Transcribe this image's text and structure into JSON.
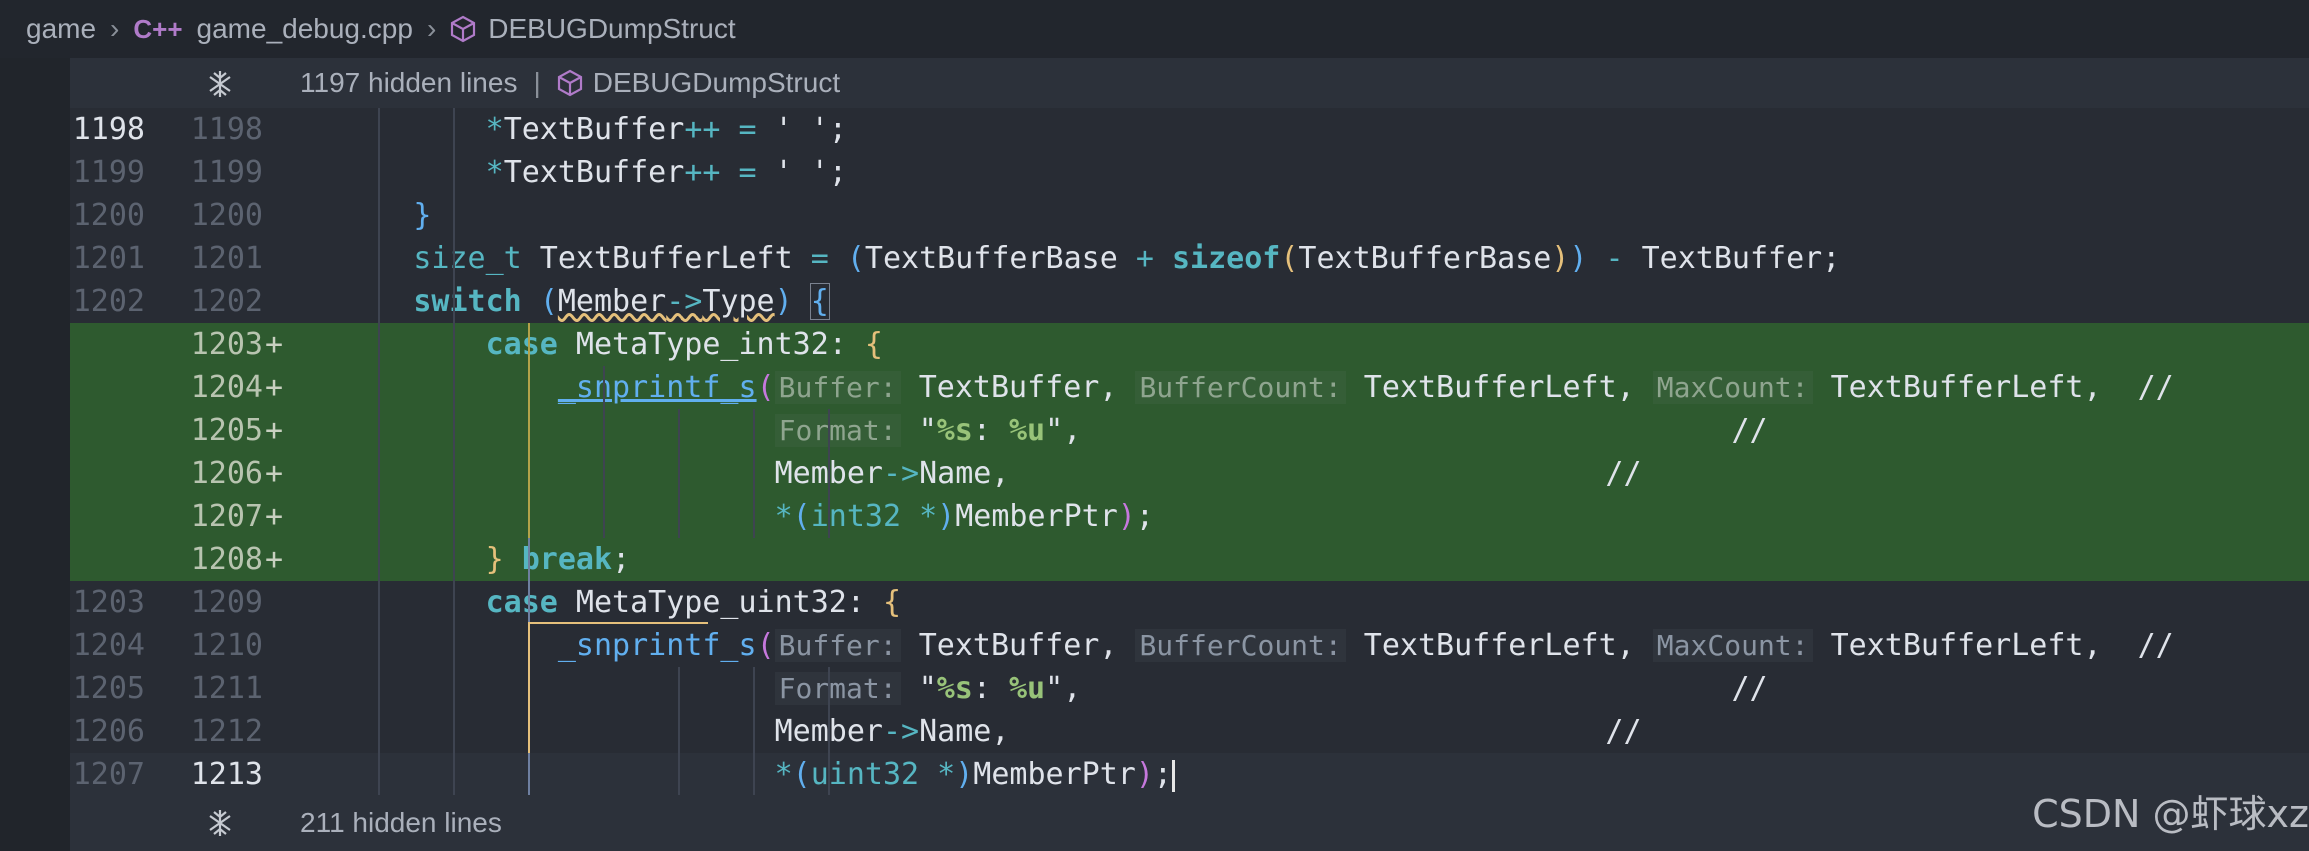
{
  "breadcrumb": {
    "folder": "game",
    "lang_icon": "C++",
    "file": "game_debug.cpp",
    "symbol": "DEBUGDumpStruct"
  },
  "fold_top": {
    "count_text": "1197 hidden lines",
    "symbol": "DEBUGDumpStruct"
  },
  "fold_bottom": {
    "count_text": "211 hidden lines"
  },
  "lines": [
    {
      "old": "1198",
      "new": "1198"
    },
    {
      "old": "1199",
      "new": "1199"
    },
    {
      "old": "1200",
      "new": "1200"
    },
    {
      "old": "1201",
      "new": "1201"
    },
    {
      "old": "1202",
      "new": "1202"
    },
    {
      "old": "",
      "new": "1203",
      "mark": "+"
    },
    {
      "old": "",
      "new": "1204",
      "mark": "+"
    },
    {
      "old": "",
      "new": "1205",
      "mark": "+"
    },
    {
      "old": "",
      "new": "1206",
      "mark": "+"
    },
    {
      "old": "",
      "new": "1207",
      "mark": "+"
    },
    {
      "old": "",
      "new": "1208",
      "mark": "+"
    },
    {
      "old": "1203",
      "new": "1209"
    },
    {
      "old": "1204",
      "new": "1210"
    },
    {
      "old": "1205",
      "new": "1211"
    },
    {
      "old": "1206",
      "new": "1212"
    },
    {
      "old": "1207",
      "new": "1213"
    }
  ],
  "watermark": "CSDN @虾球xz",
  "colors": {
    "added_bg": "#2e5a2f",
    "editor_bg": "#282c34",
    "keyword": "#56b6c2",
    "bracket": "#e5c07b"
  }
}
